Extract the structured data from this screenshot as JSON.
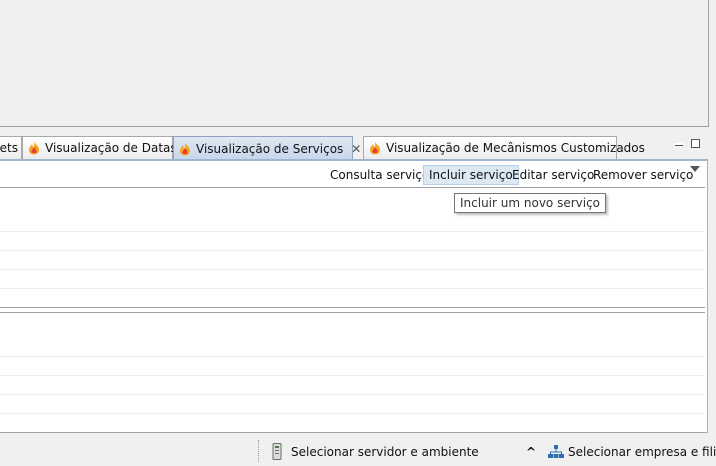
{
  "tabs": [
    {
      "label": "pets",
      "active": false
    },
    {
      "label": "Visualização de Dataset",
      "active": false,
      "icon": "flame-icon"
    },
    {
      "label": "Visualização de Serviços",
      "active": true,
      "icon": "flame-icon",
      "close": "✕"
    },
    {
      "label": "Visualização de Mecânismos Customizados",
      "active": false,
      "icon": "flame-icon"
    }
  ],
  "toolbar": {
    "consulta": "Consulta serviço",
    "incluir": "Incluir serviço",
    "editar": "Editar serviço",
    "remover": "Remover serviço"
  },
  "tooltip": {
    "text": "Incluir um novo serviço"
  },
  "status": {
    "server": "Selecionar servidor e ambiente",
    "company": "Selecionar empresa e filial",
    "arrow": "^"
  },
  "colors": {
    "accent": "#9fb5d3",
    "tab_active": "#c6d6ea",
    "hover": "#dde8f5"
  }
}
